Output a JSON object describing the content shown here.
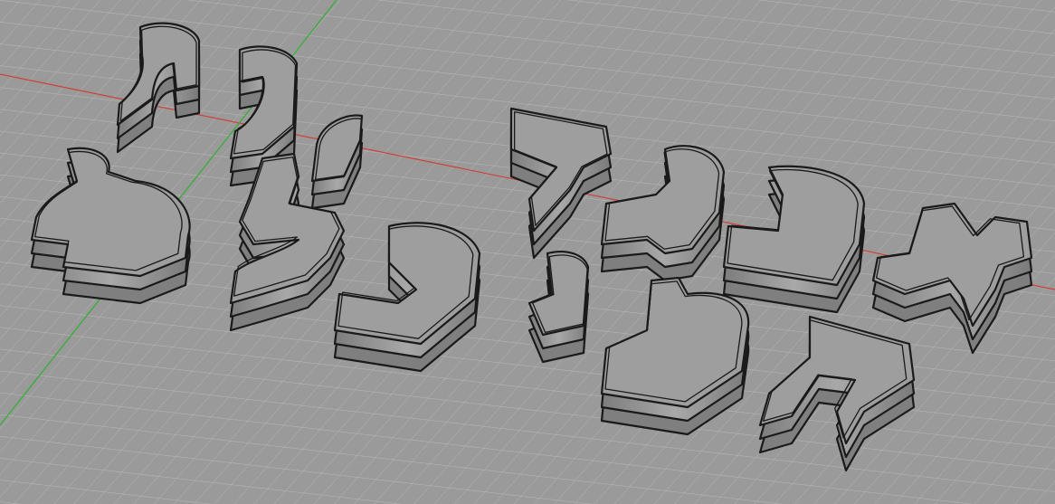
{
  "viewport": {
    "view_name": "",
    "background_color": "#9a9a9a",
    "grid_color": "#b9b9b9",
    "x_axis_color": "#d0403a",
    "y_axis_color": "#2fb030",
    "object_fill": "#8c8c8c",
    "object_stroke": "#1a1a1a"
  },
  "objects": [
    {
      "name": "letter-yod-1",
      "glyph": "yod"
    },
    {
      "name": "letter-vav-1",
      "glyph": "vav"
    },
    {
      "name": "letter-yod-2",
      "glyph": "yod"
    },
    {
      "name": "letter-tet",
      "glyph": "tet"
    },
    {
      "name": "letter-lamed",
      "glyph": "lamed"
    },
    {
      "name": "letter-kaf",
      "glyph": "kaf"
    },
    {
      "name": "letter-dalet",
      "glyph": "dalet"
    },
    {
      "name": "letter-gimel",
      "glyph": "gimel"
    },
    {
      "name": "letter-bet",
      "glyph": "bet"
    },
    {
      "name": "letter-alef",
      "glyph": "alef"
    },
    {
      "name": "letter-yod-3",
      "glyph": "yod"
    },
    {
      "name": "letter-shin-fragment",
      "glyph": "tet"
    },
    {
      "name": "letter-het",
      "glyph": "het"
    }
  ]
}
